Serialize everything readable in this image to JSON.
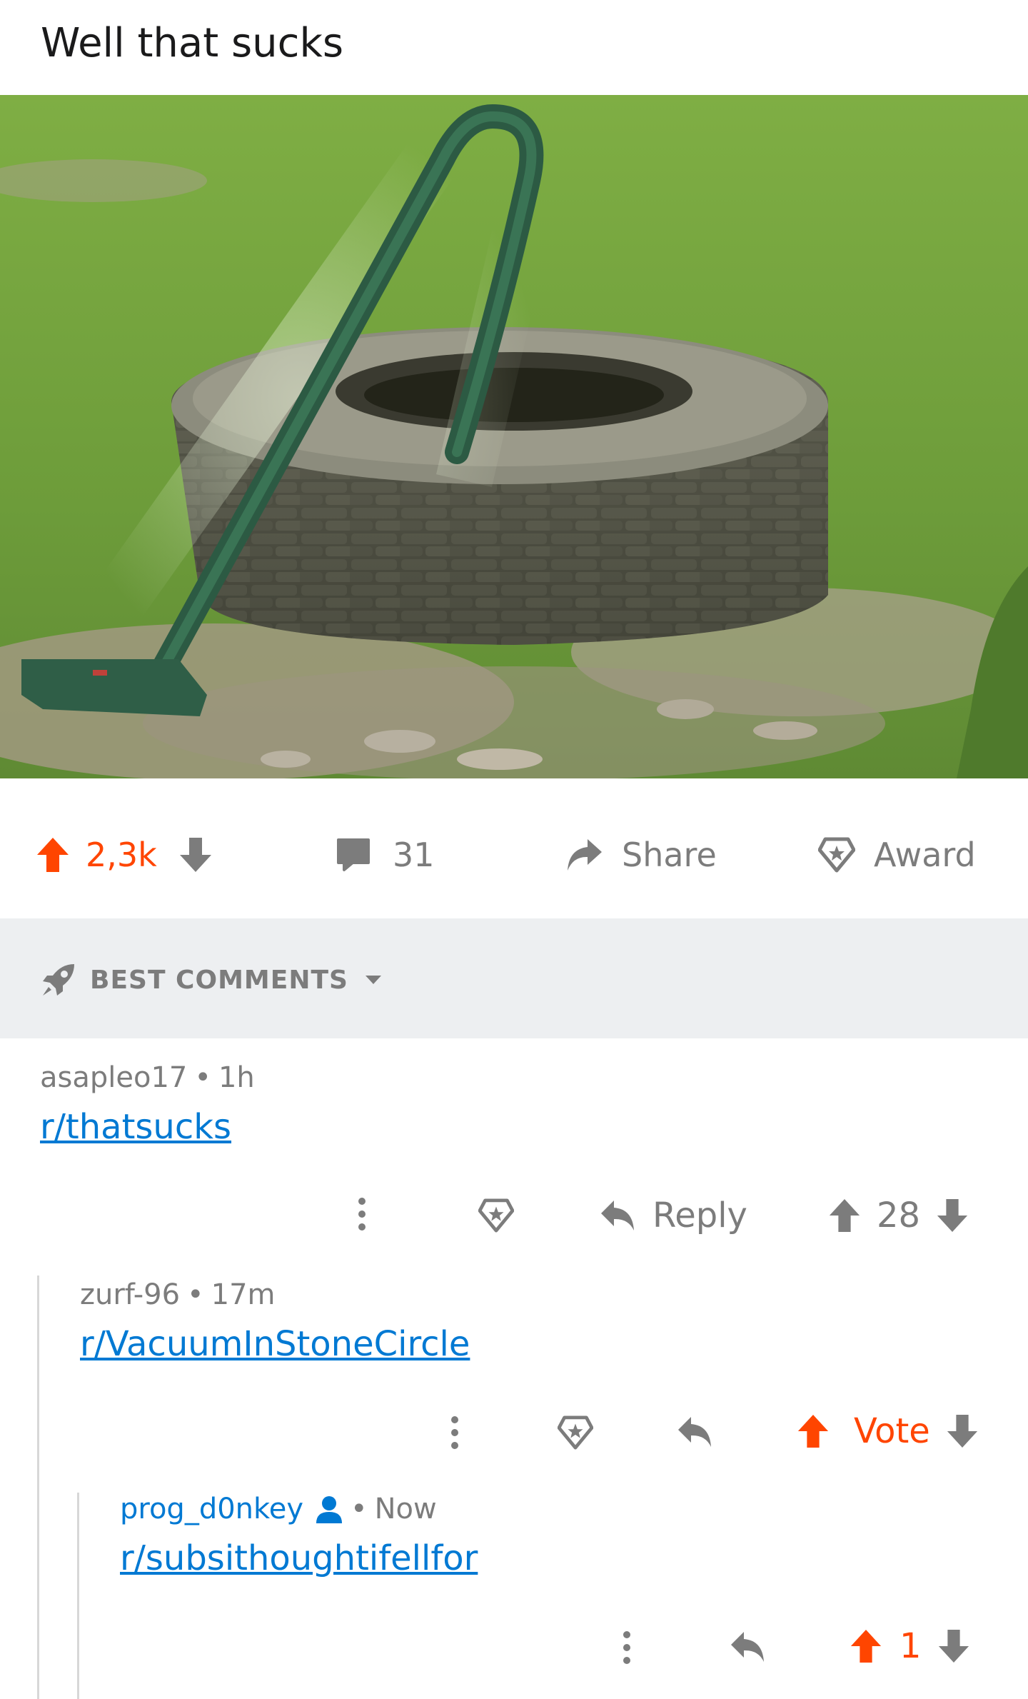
{
  "post": {
    "title": "Well that sucks",
    "upvotes": "2,3k",
    "comments_count": "31",
    "share_label": "Share",
    "award_label": "Award"
  },
  "sort": {
    "label": "BEST COMMENTS"
  },
  "comments": [
    {
      "author": "asapleo17",
      "separator": "•",
      "time": "1h",
      "body": "r/thatsucks",
      "reply_label": "Reply",
      "score": "28"
    },
    {
      "author": "zurf-96",
      "separator": "•",
      "time": "17m",
      "body": "r/VacuumInStoneCircle",
      "vote_label": "Vote"
    },
    {
      "author": "prog_d0nkey",
      "separator": "•",
      "time": "Now",
      "body": "r/subsithoughtifellfor",
      "score": "1"
    }
  ],
  "colors": {
    "accent_orange": "#ff4500",
    "link_blue": "#0079d3",
    "meta_gray": "#7c7c7c",
    "sort_bar_bg": "#edeff1"
  }
}
